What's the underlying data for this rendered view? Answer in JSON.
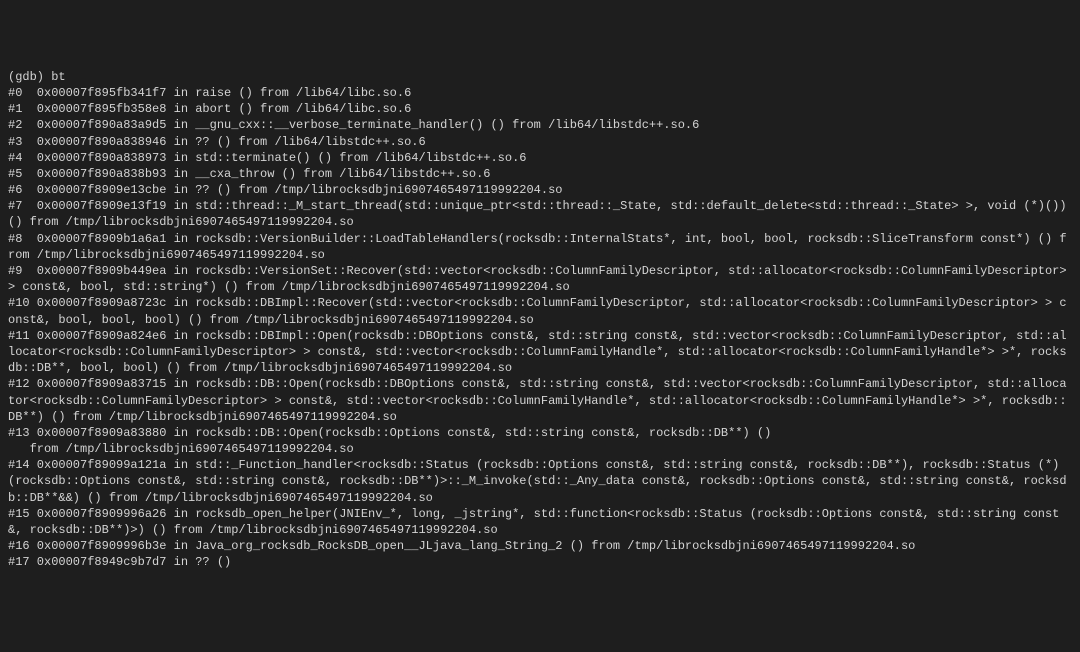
{
  "terminal": {
    "lines": [
      "(gdb) bt",
      "#0  0x00007f895fb341f7 in raise () from /lib64/libc.so.6",
      "#1  0x00007f895fb358e8 in abort () from /lib64/libc.so.6",
      "#2  0x00007f890a83a9d5 in __gnu_cxx::__verbose_terminate_handler() () from /lib64/libstdc++.so.6",
      "#3  0x00007f890a838946 in ?? () from /lib64/libstdc++.so.6",
      "#4  0x00007f890a838973 in std::terminate() () from /lib64/libstdc++.so.6",
      "#5  0x00007f890a838b93 in __cxa_throw () from /lib64/libstdc++.so.6",
      "#6  0x00007f8909e13cbe in ?? () from /tmp/librocksdbjni6907465497119992204.so",
      "#7  0x00007f8909e13f19 in std::thread::_M_start_thread(std::unique_ptr<std::thread::_State, std::default_delete<std::thread::_State> >, void (*)()) () from /tmp/librocksdbjni6907465497119992204.so",
      "#8  0x00007f8909b1a6a1 in rocksdb::VersionBuilder::LoadTableHandlers(rocksdb::InternalStats*, int, bool, bool, rocksdb::SliceTransform const*) () from /tmp/librocksdbjni6907465497119992204.so",
      "#9  0x00007f8909b449ea in rocksdb::VersionSet::Recover(std::vector<rocksdb::ColumnFamilyDescriptor, std::allocator<rocksdb::ColumnFamilyDescriptor> > const&, bool, std::string*) () from /tmp/librocksdbjni6907465497119992204.so",
      "#10 0x00007f8909a8723c in rocksdb::DBImpl::Recover(std::vector<rocksdb::ColumnFamilyDescriptor, std::allocator<rocksdb::ColumnFamilyDescriptor> > const&, bool, bool, bool) () from /tmp/librocksdbjni6907465497119992204.so",
      "#11 0x00007f8909a824e6 in rocksdb::DBImpl::Open(rocksdb::DBOptions const&, std::string const&, std::vector<rocksdb::ColumnFamilyDescriptor, std::allocator<rocksdb::ColumnFamilyDescriptor> > const&, std::vector<rocksdb::ColumnFamilyHandle*, std::allocator<rocksdb::ColumnFamilyHandle*> >*, rocksdb::DB**, bool, bool) () from /tmp/librocksdbjni6907465497119992204.so",
      "#12 0x00007f8909a83715 in rocksdb::DB::Open(rocksdb::DBOptions const&, std::string const&, std::vector<rocksdb::ColumnFamilyDescriptor, std::allocator<rocksdb::ColumnFamilyDescriptor> > const&, std::vector<rocksdb::ColumnFamilyHandle*, std::allocator<rocksdb::ColumnFamilyHandle*> >*, rocksdb::DB**) () from /tmp/librocksdbjni6907465497119992204.so",
      "#13 0x00007f8909a83880 in rocksdb::DB::Open(rocksdb::Options const&, std::string const&, rocksdb::DB**) ()",
      "   from /tmp/librocksdbjni6907465497119992204.so",
      "#14 0x00007f89099a121a in std::_Function_handler<rocksdb::Status (rocksdb::Options const&, std::string const&, rocksdb::DB**), rocksdb::Status (*)(rocksdb::Options const&, std::string const&, rocksdb::DB**)>::_M_invoke(std::_Any_data const&, rocksdb::Options const&, std::string const&, rocksdb::DB**&&) () from /tmp/librocksdbjni6907465497119992204.so",
      "#15 0x00007f8909996a26 in rocksdb_open_helper(JNIEnv_*, long, _jstring*, std::function<rocksdb::Status (rocksdb::Options const&, std::string const&, rocksdb::DB**)>) () from /tmp/librocksdbjni6907465497119992204.so",
      "#16 0x00007f8909996b3e in Java_org_rocksdb_RocksDB_open__JLjava_lang_String_2 () from /tmp/librocksdbjni6907465497119992204.so",
      "#17 0x00007f8949c9b7d7 in ?? ()"
    ]
  }
}
